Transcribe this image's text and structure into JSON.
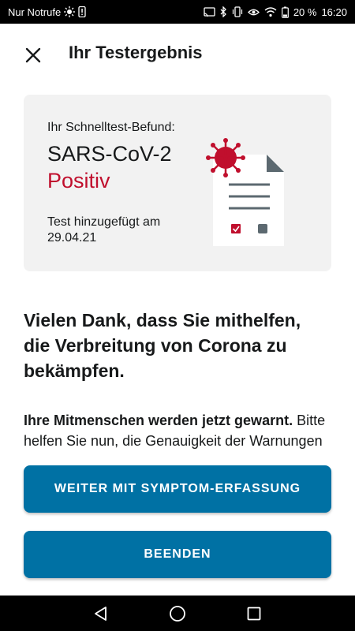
{
  "status_bar": {
    "carrier": "Nur Notrufe",
    "battery_percent": "20 %",
    "time": "16:20"
  },
  "header": {
    "title": "Ihr Testergebnis",
    "close_icon": "close-icon"
  },
  "result_card": {
    "label": "Ihr Schnelltest-Befund:",
    "virus": "SARS-CoV-2",
    "result": "Positiv",
    "added_label": "Test hinzugefügt am",
    "added_date": "29.04.21",
    "result_color": "#c00f2d",
    "illustration": "document-with-virus-icon"
  },
  "headline": "Vielen Dank, dass Sie mithelfen, die Verbreitung von Corona zu bekämpfen.",
  "body": {
    "bold_part": "Ihre Mitmenschen werden jetzt gewarnt.",
    "regular_part": " Bitte helfen Sie nun, die Genauigkeit der Warnungen zu"
  },
  "buttons": {
    "primary_label": "WEITER MIT SYMPTOM-ERFASSUNG",
    "secondary_label": "BEENDEN",
    "color": "#0071a4"
  },
  "navbar": {
    "back_icon": "back-triangle-icon",
    "home_icon": "home-circle-icon",
    "recents_icon": "recents-square-icon"
  }
}
